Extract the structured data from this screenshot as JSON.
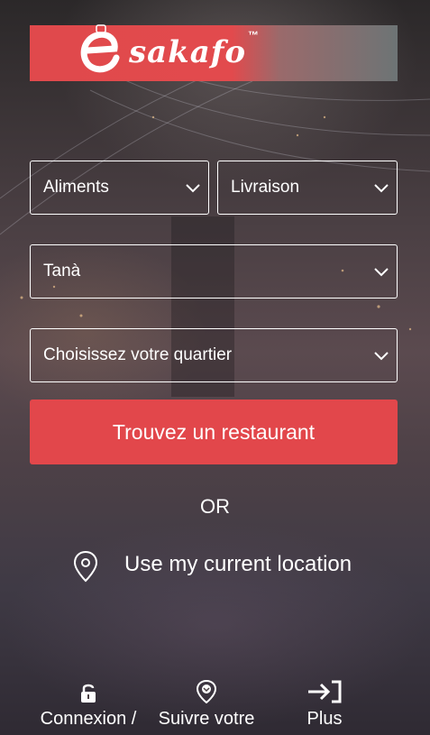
{
  "logo": {
    "text": "sakafo",
    "letter": "e",
    "trademark": "™"
  },
  "filters": {
    "category": "Aliments",
    "mode": "Livraison",
    "city": "Tanà",
    "district_placeholder": "Choisissez votre quartier"
  },
  "cta": {
    "label": "Trouvez un restaurant"
  },
  "separator": "OR",
  "location": {
    "label": "Use my current location",
    "icon": "map-pin-icon"
  },
  "bottom_nav": {
    "items": [
      {
        "label": "Connexion /",
        "icon": "lock-icon"
      },
      {
        "label": "Suivre votre",
        "icon": "track-pin-icon"
      },
      {
        "label": "Plus",
        "icon": "arrow-right-bracket-icon"
      }
    ]
  },
  "colors": {
    "accent": "#e2474b",
    "text": "#ffffff",
    "border": "#ffffff"
  }
}
